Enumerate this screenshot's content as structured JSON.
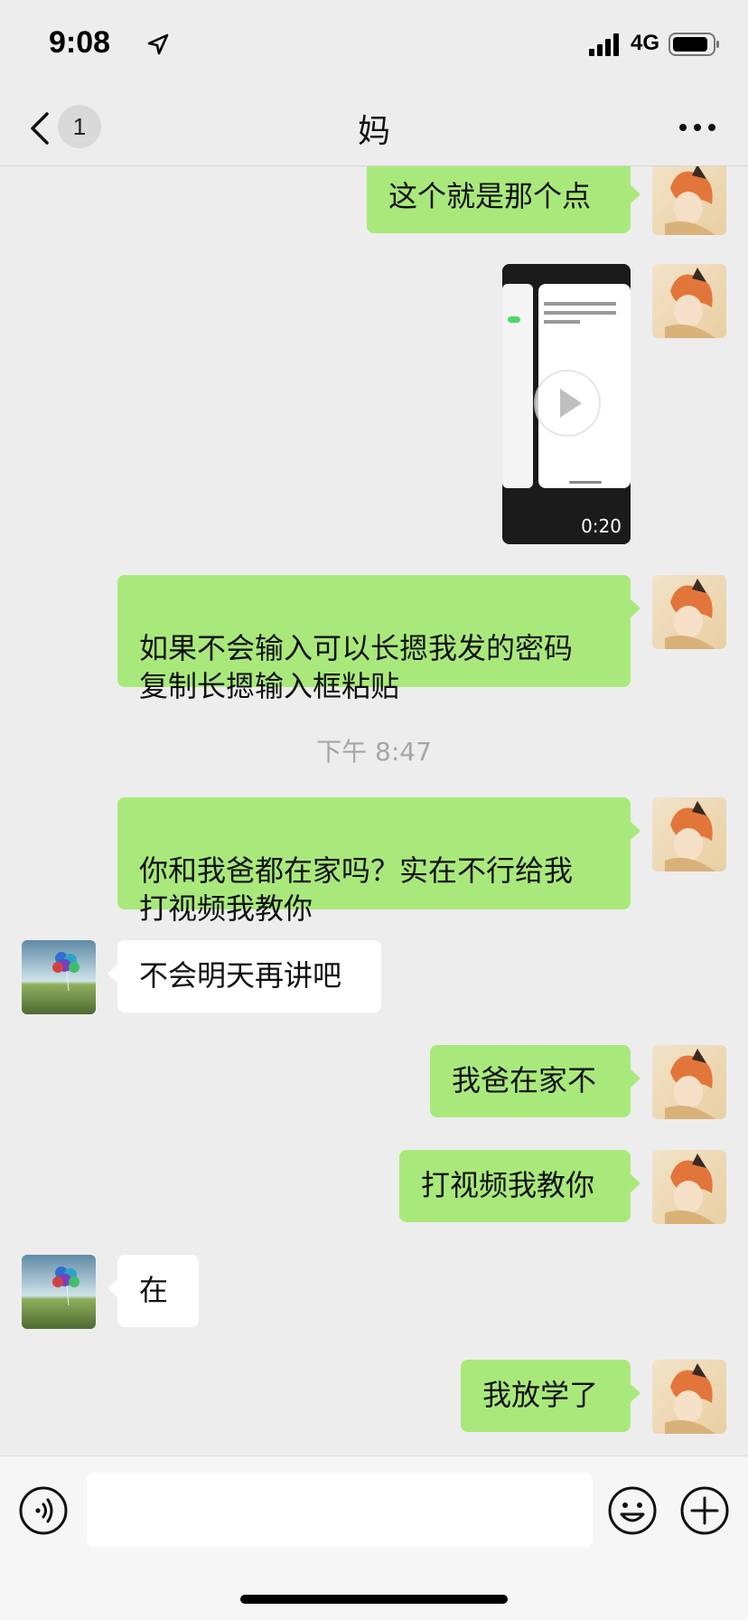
{
  "status_bar": {
    "time": "9:08",
    "network": "4G"
  },
  "nav": {
    "back_count": "1",
    "title": "妈",
    "icons": {
      "back": "chevron-left-icon",
      "more": "ellipsis-icon"
    }
  },
  "messages": [
    {
      "sender": "me",
      "type": "text",
      "text": "这个就是那个点"
    },
    {
      "sender": "me",
      "type": "video",
      "duration": "0:20"
    },
    {
      "sender": "me",
      "type": "text",
      "text": "如果不会输入可以长摁我发的密码\n复制长摁输入框粘贴"
    },
    {
      "type": "timestamp",
      "text": "下午 8:47"
    },
    {
      "sender": "me",
      "type": "text",
      "text": "你和我爸都在家吗？实在不行给我\n打视频我教你"
    },
    {
      "sender": "them",
      "type": "text",
      "text": "不会明天再讲吧"
    },
    {
      "sender": "me",
      "type": "text",
      "text": "我爸在家不"
    },
    {
      "sender": "me",
      "type": "text",
      "text": "打视频我教你"
    },
    {
      "sender": "them",
      "type": "text",
      "text": "在"
    },
    {
      "sender": "me",
      "type": "text",
      "text": "我放学了"
    }
  ],
  "input_bar": {
    "placeholder": "",
    "icons": {
      "voice": "voice-icon",
      "emoji": "emoji-icon",
      "more": "plus-icon"
    }
  },
  "colors": {
    "background": "#ededed",
    "my_bubble": "#a9e97b",
    "their_bubble": "#ffffff",
    "timestamp_text": "#a5a5a5"
  }
}
